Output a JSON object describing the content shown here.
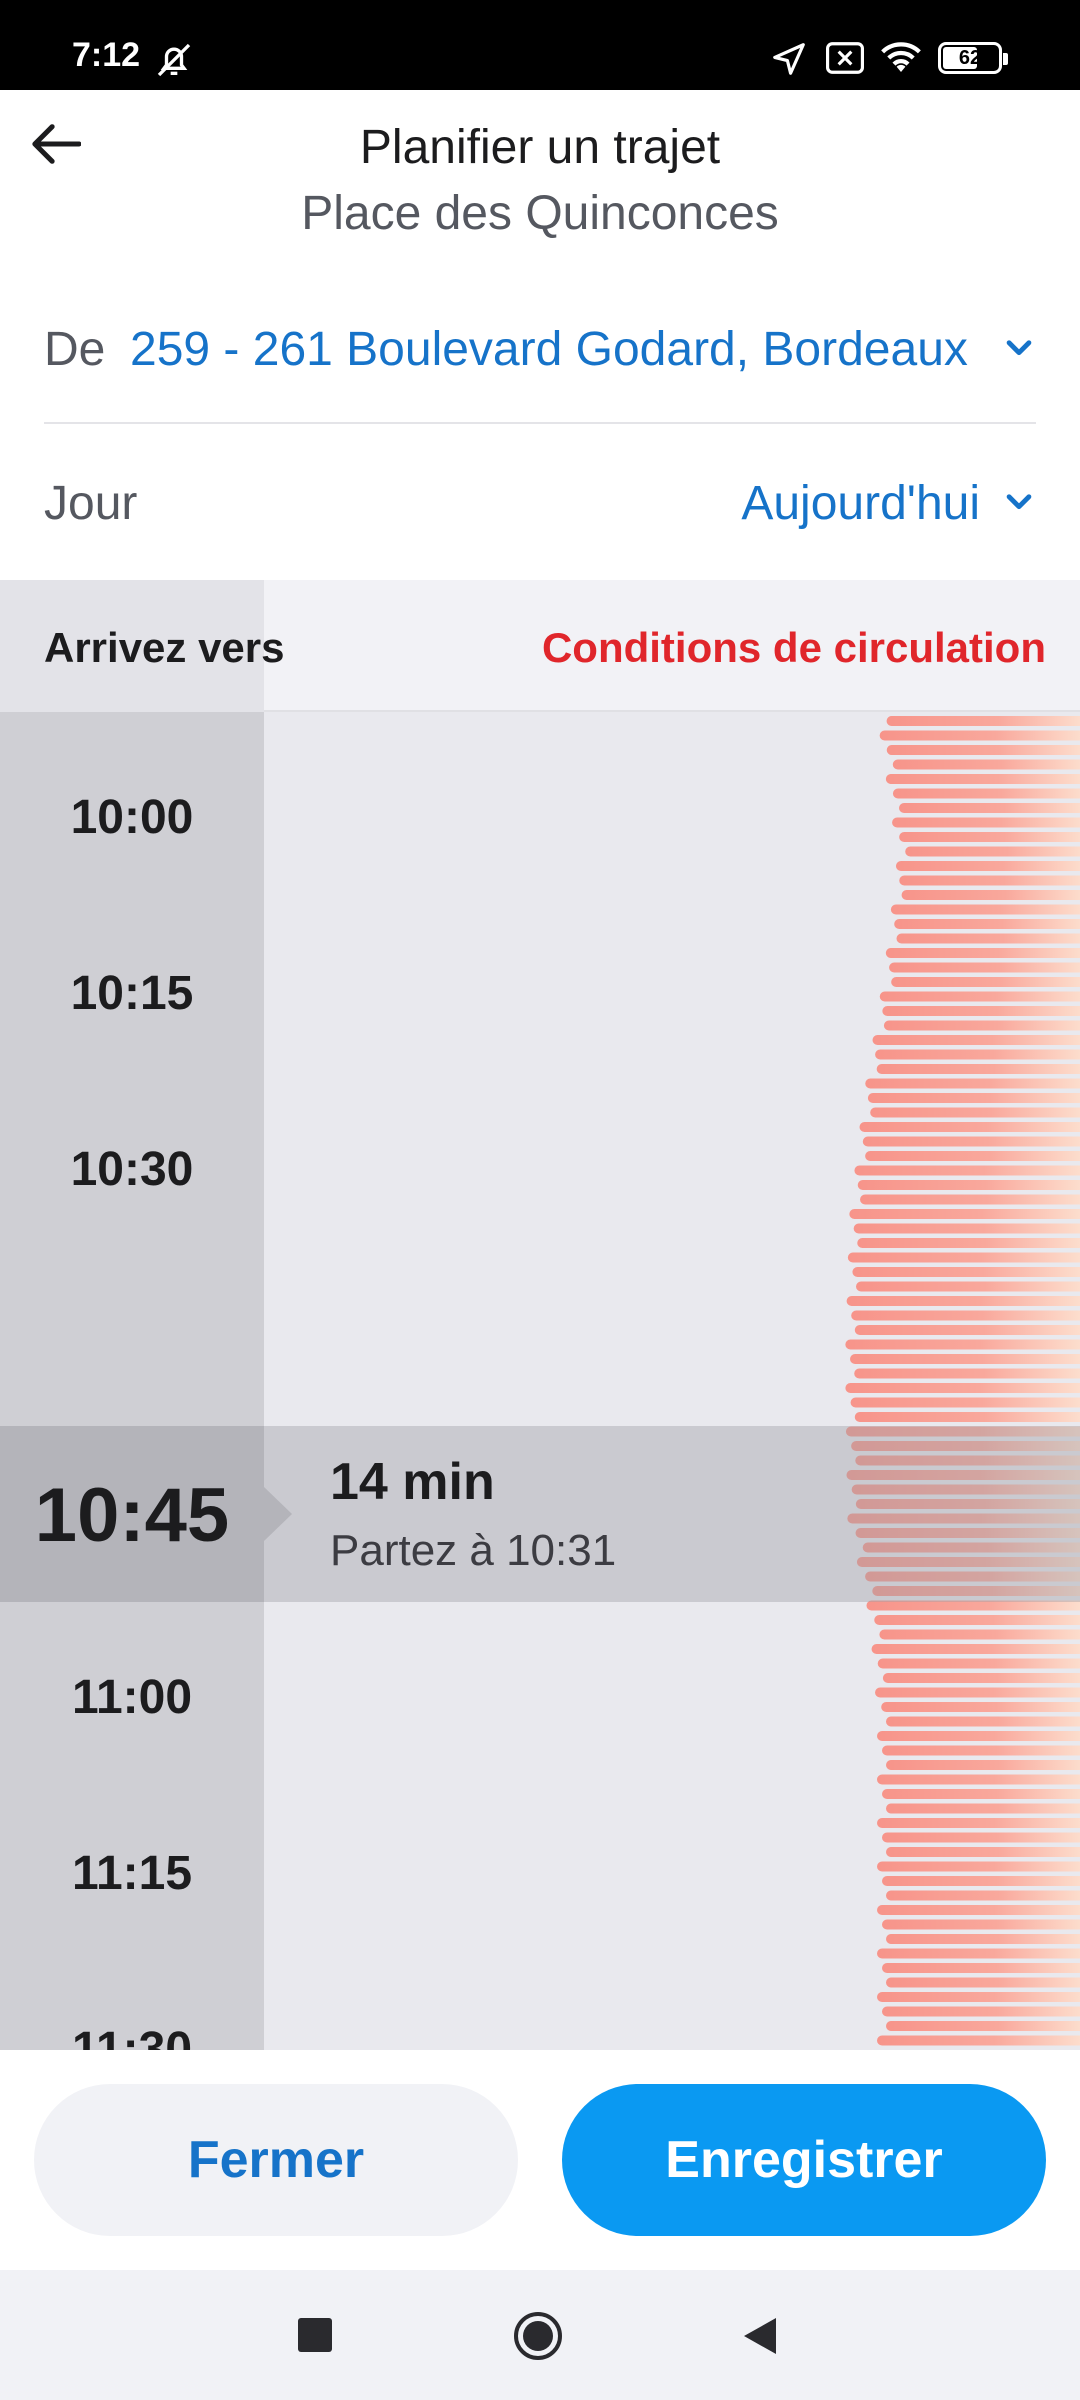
{
  "status_bar": {
    "time": "7:12",
    "battery": "62",
    "icons": [
      "bell-off-icon",
      "location-arrow-icon",
      "screen-cast-icon",
      "wifi-icon",
      "battery-icon"
    ]
  },
  "header": {
    "back_icon": "arrow-left-icon",
    "title": "Planifier un trajet",
    "subtitle": "Place des Quinconces"
  },
  "from": {
    "label": "De",
    "value": "259 - 261 Boulevard Godard, Bordeaux",
    "chevron_icon": "chevron-down-icon"
  },
  "day": {
    "label": "Jour",
    "value": "Aujourd'hui",
    "chevron_icon": "chevron-down-icon"
  },
  "timeline": {
    "arrive_label": "Arrivez vers",
    "traffic_label": "Conditions de circulation",
    "times": [
      "10:00",
      "10:15",
      "10:30",
      "11:00",
      "11:15",
      "11:30"
    ],
    "selected": {
      "time": "10:45",
      "duration": "14 min",
      "depart": "Partez à 10:31"
    },
    "colors": {
      "traffic": "#f7948a",
      "selected_band": "#b4b4ba",
      "traffic_label": "#e0262b"
    }
  },
  "footer": {
    "close_label": "Fermer",
    "save_label": "Enregistrer",
    "accent": "#0a99f2",
    "link": "#1673c9"
  },
  "nav_bar": {
    "icons": [
      "recent-apps-icon",
      "home-icon",
      "back-icon"
    ]
  }
}
